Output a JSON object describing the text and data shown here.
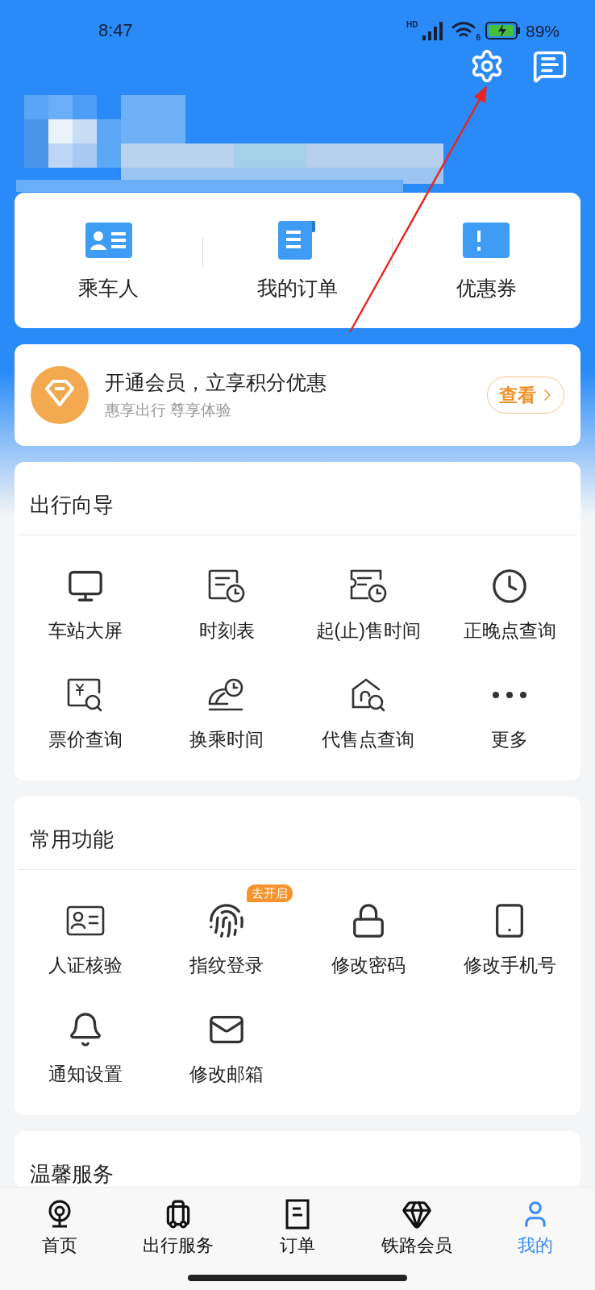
{
  "status_bar": {
    "time": "8:47",
    "network": "HD",
    "wifi_band": "6",
    "battery": "89%"
  },
  "quick_links": [
    {
      "label": "乘车人"
    },
    {
      "label": "我的订单"
    },
    {
      "label": "优惠券"
    }
  ],
  "membership": {
    "title": "开通会员，立享积分优惠",
    "subtitle": "惠享出行 尊享体验",
    "button": "查看"
  },
  "sections": [
    {
      "title": "出行向导",
      "items": [
        {
          "label": "车站大屏"
        },
        {
          "label": "时刻表"
        },
        {
          "label": "起(止)售时间"
        },
        {
          "label": "正晚点查询"
        },
        {
          "label": "票价查询"
        },
        {
          "label": "换乘时间"
        },
        {
          "label": "代售点查询"
        },
        {
          "label": "更多"
        }
      ]
    },
    {
      "title": "常用功能",
      "items": [
        {
          "label": "人证核验"
        },
        {
          "label": "指纹登录",
          "badge": "去开启"
        },
        {
          "label": "修改密码"
        },
        {
          "label": "修改手机号"
        },
        {
          "label": "通知设置"
        },
        {
          "label": "修改邮箱"
        }
      ]
    },
    {
      "title": "温馨服务"
    }
  ],
  "tab_bar": [
    {
      "label": "首页",
      "selected": false
    },
    {
      "label": "出行服务",
      "selected": false
    },
    {
      "label": "订单",
      "selected": false
    },
    {
      "label": "铁路会员",
      "selected": false
    },
    {
      "label": "我的",
      "selected": true
    }
  ]
}
